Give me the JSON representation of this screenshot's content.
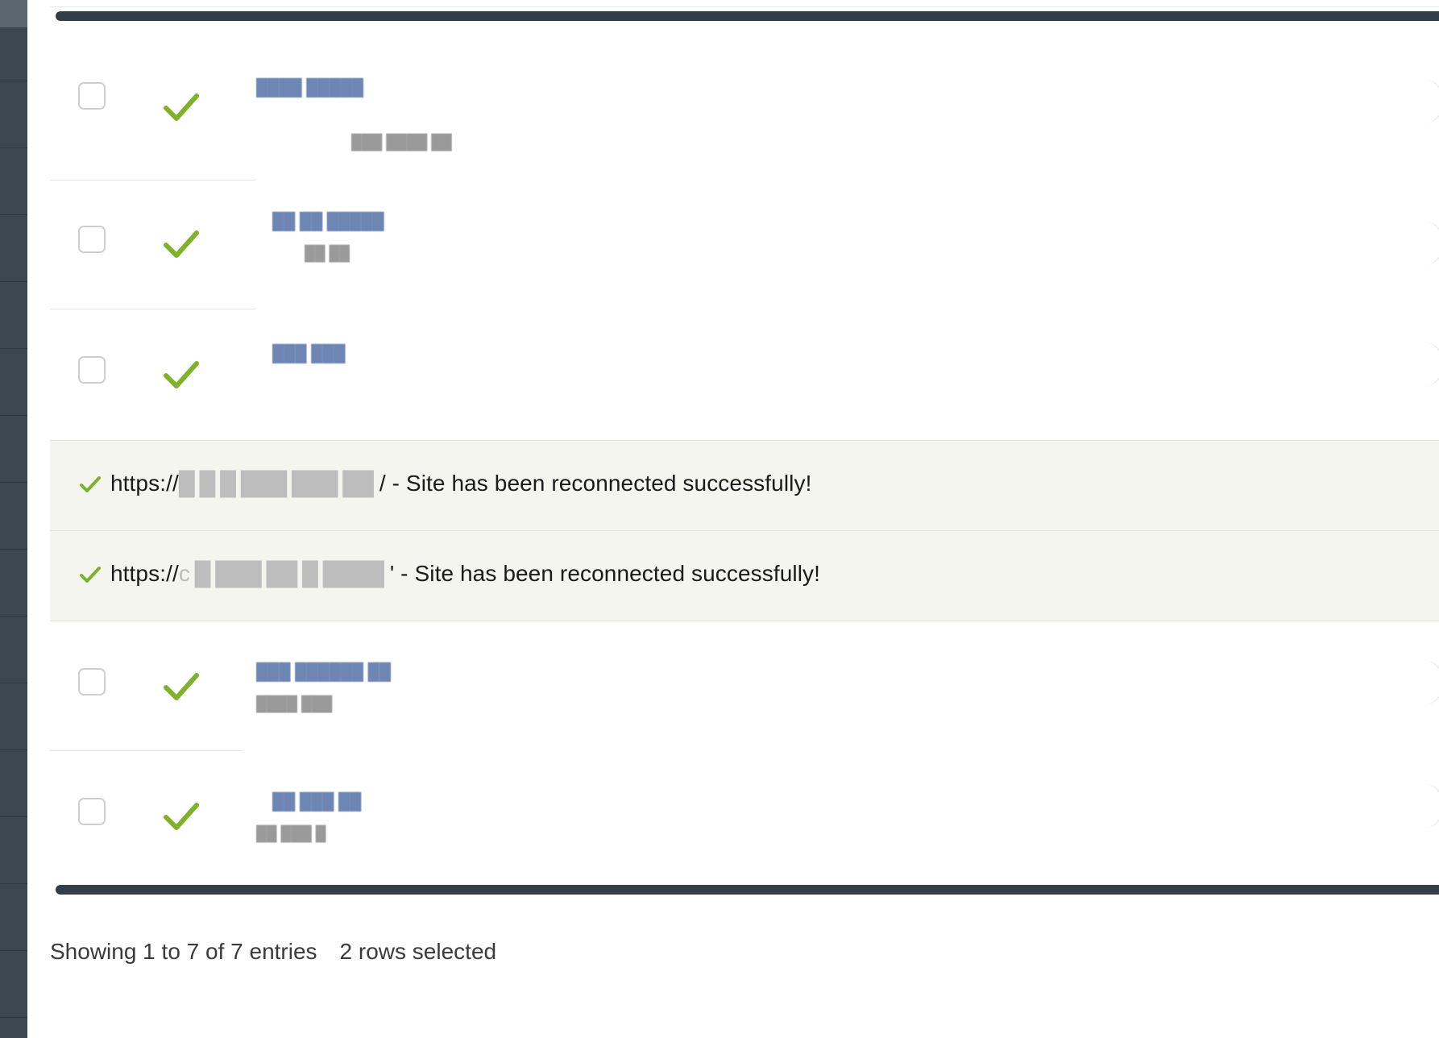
{
  "colors": {
    "accent_check": "#7fb12b",
    "scrollbar": "#333d47",
    "notice_bg": "#f4f5ef",
    "sidebar": "#3d4751"
  },
  "table": {
    "rows": [
      {
        "selected": false,
        "status_icon": "check-icon",
        "site": "████ █████",
        "meta": "███ ████ ██"
      },
      {
        "selected": false,
        "status_icon": "check-icon",
        "site": "██ ██ █████",
        "meta": "██ ██"
      },
      {
        "selected": false,
        "status_icon": "check-icon",
        "site": "███ ███",
        "meta": ""
      },
      {
        "selected": false,
        "status_icon": "check-icon",
        "site": "███ ██████ ██",
        "meta": "████ ███"
      },
      {
        "selected": false,
        "status_icon": "check-icon",
        "site": "██ ███ ██",
        "meta": "██ ███ █"
      }
    ]
  },
  "notices": [
    {
      "icon": "check-icon",
      "prefix": "https://",
      "masked": "█ █ █   ███ ███ ██",
      "suffix": "/ - Site has been reconnected successfully!"
    },
    {
      "icon": "check-icon",
      "prefix": "https://",
      "masked": "c █ ███ ██ █ ████",
      "suffix": "' - Site has been reconnected successfully!"
    }
  ],
  "footer": {
    "showing": "Showing 1 to 7 of 7 entries",
    "selected": "2 rows selected"
  }
}
